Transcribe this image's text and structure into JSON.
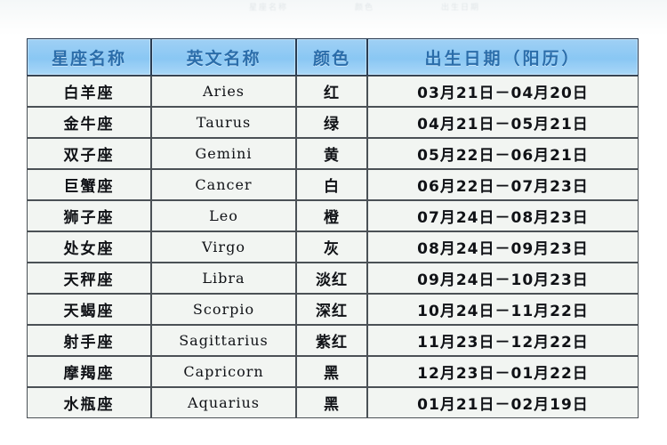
{
  "page": {
    "background_color": "#ffffff",
    "ghost_text_top": [
      "星座名称",
      "颜色",
      "出生日期"
    ]
  },
  "table": {
    "name": "zodiac-sign-reference-table",
    "header_fill": "#8fc7ef",
    "header_text_color": "#2e6ea8",
    "row_fill": "#eef0ee",
    "border_color": "#4d5358",
    "columns": [
      {
        "key": "name",
        "label": "星座名称"
      },
      {
        "key": "en",
        "label": "英文名称"
      },
      {
        "key": "color",
        "label": "颜色"
      },
      {
        "key": "date",
        "label": "出生日期（阳历）"
      }
    ],
    "rows": [
      {
        "name": "白羊座",
        "en": "Aries",
        "color": "红",
        "date": "03月21日－04月20日"
      },
      {
        "name": "金牛座",
        "en": "Taurus",
        "color": "绿",
        "date": "04月21日－05月21日"
      },
      {
        "name": "双子座",
        "en": "Gemini",
        "color": "黄",
        "date": "05月22日－06月21日"
      },
      {
        "name": "巨蟹座",
        "en": "Cancer",
        "color": "白",
        "date": "06月22日－07月23日"
      },
      {
        "name": "狮子座",
        "en": "Leo",
        "color": "橙",
        "date": "07月24日－08月23日"
      },
      {
        "name": "处女座",
        "en": "Virgo",
        "color": "灰",
        "date": "08月24日－09月23日"
      },
      {
        "name": "天秤座",
        "en": "Libra",
        "color": "淡红",
        "date": "09月24日－10月23日"
      },
      {
        "name": "天蝎座",
        "en": "Scorpio",
        "color": "深红",
        "date": "10月24日－11月22日"
      },
      {
        "name": "射手座",
        "en": "Sagittarius",
        "color": "紫红",
        "date": "11月23日－12月22日"
      },
      {
        "name": "摩羯座",
        "en": "Capricorn",
        "color": "黑",
        "date": "12月23日－01月22日"
      },
      {
        "name": "水瓶座",
        "en": "Aquarius",
        "color": "黑",
        "date": "01月21日－02月19日"
      }
    ]
  }
}
